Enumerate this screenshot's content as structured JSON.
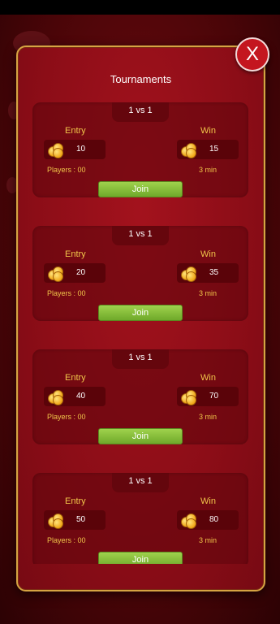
{
  "modal": {
    "title": "Tournaments",
    "close_label": "X"
  },
  "labels": {
    "entry": "Entry",
    "win": "Win",
    "join": "Join"
  },
  "tournaments": [
    {
      "mode": "1 vs 1",
      "entry": "10",
      "win": "15",
      "players": "Players : 00",
      "time": "3 min"
    },
    {
      "mode": "1 vs 1",
      "entry": "20",
      "win": "35",
      "players": "Players : 00",
      "time": "3 min"
    },
    {
      "mode": "1 vs 1",
      "entry": "40",
      "win": "70",
      "players": "Players : 00",
      "time": "3 min"
    },
    {
      "mode": "1 vs 1",
      "entry": "50",
      "win": "80",
      "players": "Players : 00",
      "time": "3 min"
    }
  ],
  "colors": {
    "modal_bg": "#8c0d17",
    "modal_border": "#d6a443",
    "label_gold": "#f0c54a",
    "join_green": "#8bc53f",
    "close_red": "#c4161f"
  },
  "icons": {
    "coin": "coin-stack-icon",
    "close": "close-icon"
  }
}
